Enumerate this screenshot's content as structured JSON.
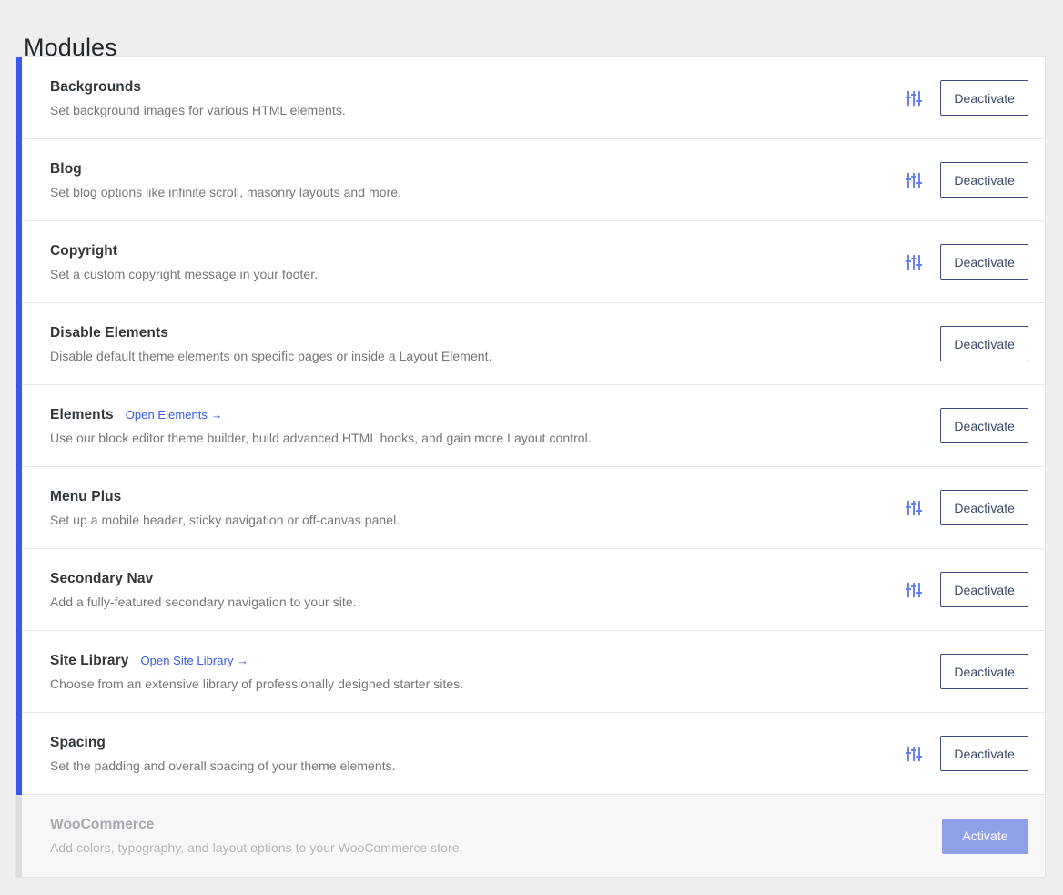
{
  "page": {
    "title": "Modules"
  },
  "accent": {
    "bar_color": "#3858e9",
    "link_color": "#3858e9",
    "inactive_bar_color": "#dcdcdf",
    "activate_button_color": "#8f9fe8",
    "deactivate_border_color": "#3a4a7d"
  },
  "actions": {
    "deactivate_label": "Deactivate",
    "activate_label": "Activate",
    "settings_icon": "sliders-icon"
  },
  "modules": [
    {
      "name": "Backgrounds",
      "description": "Set background images for various HTML elements.",
      "link": null,
      "has_settings": true,
      "active": true,
      "button": "Deactivate"
    },
    {
      "name": "Blog",
      "description": "Set blog options like infinite scroll, masonry layouts and more.",
      "link": null,
      "has_settings": true,
      "active": true,
      "button": "Deactivate"
    },
    {
      "name": "Copyright",
      "description": "Set a custom copyright message in your footer.",
      "link": null,
      "has_settings": true,
      "active": true,
      "button": "Deactivate"
    },
    {
      "name": "Disable Elements",
      "description": "Disable default theme elements on specific pages or inside a Layout Element.",
      "link": null,
      "has_settings": false,
      "active": true,
      "button": "Deactivate"
    },
    {
      "name": "Elements",
      "description": "Use our block editor theme builder, build advanced HTML hooks, and gain more Layout control.",
      "link": "Open Elements →",
      "has_settings": false,
      "active": true,
      "button": "Deactivate"
    },
    {
      "name": "Menu Plus",
      "description": "Set up a mobile header, sticky navigation or off-canvas panel.",
      "link": null,
      "has_settings": true,
      "active": true,
      "button": "Deactivate"
    },
    {
      "name": "Secondary Nav",
      "description": "Add a fully-featured secondary navigation to your site.",
      "link": null,
      "has_settings": true,
      "active": true,
      "button": "Deactivate"
    },
    {
      "name": "Site Library",
      "description": "Choose from an extensive library of professionally designed starter sites.",
      "link": "Open Site Library →",
      "has_settings": false,
      "active": true,
      "button": "Deactivate"
    },
    {
      "name": "Spacing",
      "description": "Set the padding and overall spacing of your theme elements.",
      "link": null,
      "has_settings": true,
      "active": true,
      "button": "Deactivate"
    },
    {
      "name": "WooCommerce",
      "description": "Add colors, typography, and layout options to your WooCommerce store.",
      "link": null,
      "has_settings": false,
      "active": false,
      "button": "Activate"
    }
  ]
}
